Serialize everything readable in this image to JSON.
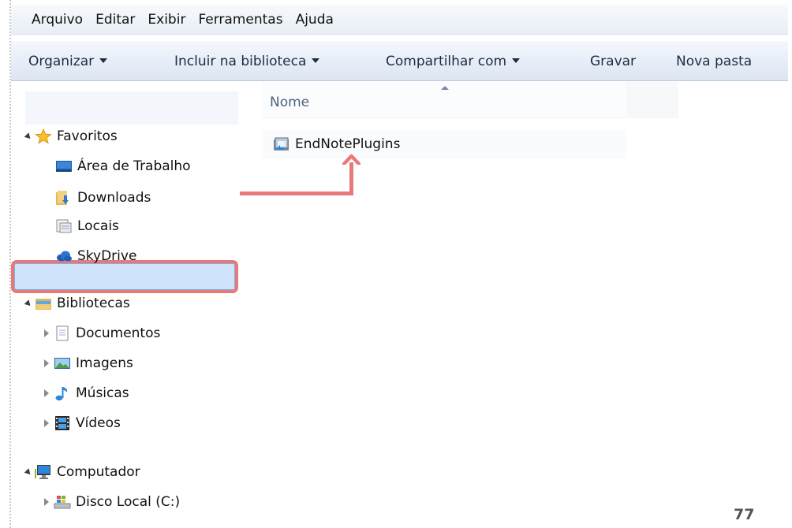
{
  "menubar": {
    "items": [
      "Arquivo",
      "Editar",
      "Exibir",
      "Ferramentas",
      "Ajuda"
    ]
  },
  "toolbar": {
    "organize": "Organizar",
    "include": "Incluir na biblioteca",
    "share": "Compartilhar com",
    "burn": "Gravar",
    "new_folder": "Nova pasta"
  },
  "nav": {
    "favorites": {
      "label": "Favoritos",
      "items": [
        "Área de Trabalho",
        "Downloads",
        "Locais",
        "SkyDrive"
      ]
    },
    "libraries": {
      "label": "Bibliotecas",
      "items": [
        "Documentos",
        "Imagens",
        "Músicas",
        "Vídeos"
      ]
    },
    "computer": {
      "label": "Computador",
      "items": [
        "Disco Local (C:)"
      ]
    }
  },
  "content": {
    "column_name": "Nome",
    "files": [
      "EndNotePlugins"
    ]
  },
  "annotation": {
    "color": "#e8797b"
  },
  "page_number": "77"
}
